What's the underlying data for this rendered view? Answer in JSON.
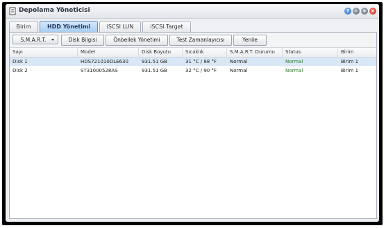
{
  "window": {
    "title": "Depolama Yöneticisi"
  },
  "tabs": [
    {
      "label": "Birim"
    },
    {
      "label": "HDD Yönetimi"
    },
    {
      "label": "iSCSI LUN"
    },
    {
      "label": "iSCSI Target"
    }
  ],
  "toolbar": {
    "smart_label": "S.M.A.R.T.",
    "disk_info_label": "Disk Bilgisi",
    "cache_label": "Önbellek Yönetimi",
    "speed_test_label": "Test Zamanlayıcısı",
    "refresh_label": "Yenile"
  },
  "table": {
    "headers": [
      "Sayı",
      "Model",
      "Disk Boyutu",
      "Sıcaklık",
      "S.M.A.R.T. Durumu",
      "Status",
      "Birim"
    ],
    "rows": [
      [
        "Disk 1",
        "HDS721010DLE630",
        "931.51 GB",
        "31 °C / 88 °F",
        "Normal",
        "Normal",
        "Birim 1"
      ],
      [
        "Disk 2",
        "ST31000528AS",
        "931.51 GB",
        "32 °C / 90 °F",
        "Normal",
        "Normal",
        "Birim 1"
      ]
    ]
  },
  "colors": {
    "active_tab": "#a9cdf1",
    "selected_row": "#d9e8f7",
    "status_ok": "#2f7a2f"
  },
  "icons": [
    "storage-manager-icon",
    "help-icon",
    "minimize-icon",
    "maximize-icon",
    "close-icon",
    "dropdown-caret-icon"
  ]
}
